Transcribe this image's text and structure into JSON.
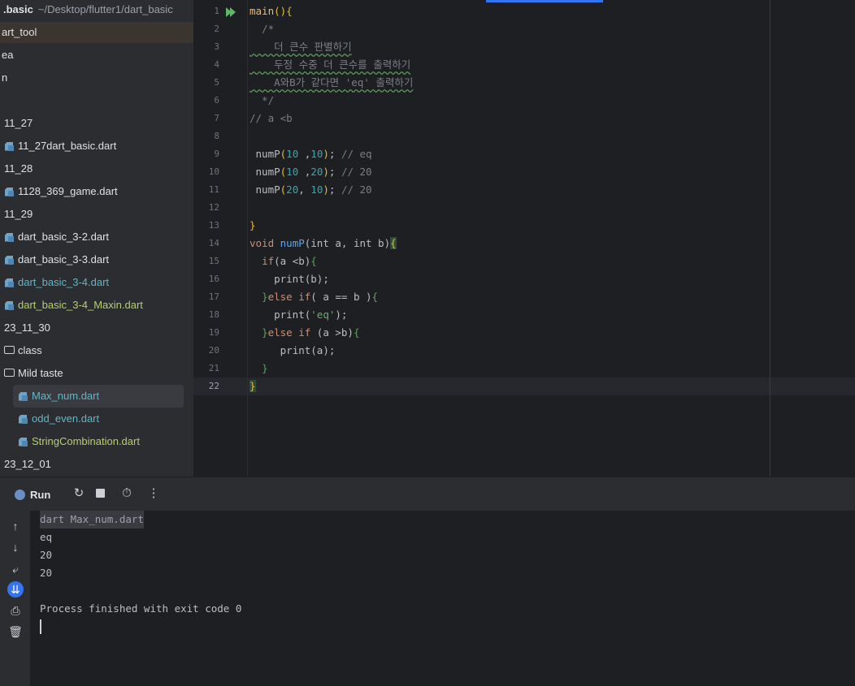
{
  "project": {
    "header_name": ".basic",
    "header_path": "~/Desktop/flutter1/dart_basic",
    "items": [
      {
        "label": "art_tool",
        "type": "plain",
        "color": "normal"
      },
      {
        "label": "ea",
        "type": "plain",
        "color": "normal"
      },
      {
        "label": "n",
        "type": "plain",
        "color": "normal"
      },
      {
        "label": "11_27",
        "type": "plain",
        "color": "normal"
      },
      {
        "label": "11_27dart_basic.dart",
        "type": "dart",
        "color": "normal"
      },
      {
        "label": "11_28",
        "type": "plain",
        "color": "normal"
      },
      {
        "label": "1128_369_game.dart",
        "type": "dart",
        "color": "normal"
      },
      {
        "label": "11_29",
        "type": "plain",
        "color": "normal"
      },
      {
        "label": "dart_basic_3-2.dart",
        "type": "dart",
        "color": "normal"
      },
      {
        "label": "dart_basic_3-3.dart",
        "type": "dart",
        "color": "normal"
      },
      {
        "label": "dart_basic_3-4.dart",
        "type": "dart",
        "color": "cyan"
      },
      {
        "label": "dart_basic_3-4_Maxin.dart",
        "type": "dart",
        "color": "green"
      },
      {
        "label": "23_11_30",
        "type": "plain",
        "color": "normal"
      },
      {
        "label": "class",
        "type": "folder",
        "color": "normal"
      },
      {
        "label": "Mild taste",
        "type": "folder",
        "color": "normal"
      },
      {
        "label": "Max_num.dart",
        "type": "dart",
        "color": "cyan"
      },
      {
        "label": "odd_even.dart",
        "type": "dart",
        "color": "cyan"
      },
      {
        "label": "StringCombination.dart",
        "type": "dart",
        "color": "green"
      },
      {
        "label": "23_12_01",
        "type": "plain",
        "color": "normal"
      }
    ]
  },
  "editor": {
    "line_numbers": [
      "1",
      "2",
      "3",
      "4",
      "5",
      "6",
      "7",
      "8",
      "9",
      "10",
      "11",
      "12",
      "13",
      "14",
      "15",
      "16",
      "17",
      "18",
      "19",
      "20",
      "21",
      "22"
    ],
    "current_line": "22",
    "code": {
      "l1_fn": "main",
      "l1_rest": "(){",
      "l2": "  /*",
      "l3": "    더 큰수 판별하기",
      "l4": "    두정 수중 더 큰수를 출력하기",
      "l5": "    A와B가 같다면 'eq' 출력하기",
      "l6": "  */",
      "l7": "// a <b",
      "call1_name": "numP",
      "call1_a": "10",
      "call1_b": "10",
      "call1_comment": "// eq",
      "call2_name": "numP",
      "call2_a": "10",
      "call2_b": "20",
      "call2_comment": "// 20",
      "call3_name": "numP",
      "call3_a": "20",
      "call3_b": "10",
      "call3_comment": "// 20",
      "l13": "}",
      "l14_void": "void",
      "l14_name": "numP",
      "l14_params": "(int a, int b)",
      "l14_brace": "{",
      "l15_if": "if",
      "l15_cond": "(a <b)",
      "l15_brace": "{",
      "l16_print": "print",
      "l16_arg": "(b);",
      "l17_close": "}",
      "l17_else": "else if",
      "l17_cond": "( a == b )",
      "l17_brace": "{",
      "l18_print": "print",
      "l18_str": "'eq'",
      "l19_close": "}",
      "l19_else": "else if",
      "l19_cond": " (a >b)",
      "l19_brace": "{",
      "l20_print": "print",
      "l20_arg": "(a);",
      "l21": "}",
      "l22": "}"
    }
  },
  "run": {
    "tab_label": "Run",
    "toolbar_icons": [
      "rerun-icon",
      "stop-icon",
      "timer-icon",
      "more-icon"
    ],
    "side_icons": [
      "arrow-up-icon",
      "arrow-down-icon",
      "soft-wrap-icon",
      "scroll-to-end-icon",
      "print-icon",
      "trash-icon"
    ],
    "console_lines": [
      "dart Max_num.dart",
      "eq",
      "20",
      "20",
      "",
      "Process finished with exit code 0"
    ]
  },
  "colors": {
    "accent": "#3574f0",
    "keyword": "#cf8e6d",
    "function": "#56a8f5",
    "number": "#2aacb8",
    "string": "#6aab73",
    "comment": "#7a7e85"
  }
}
